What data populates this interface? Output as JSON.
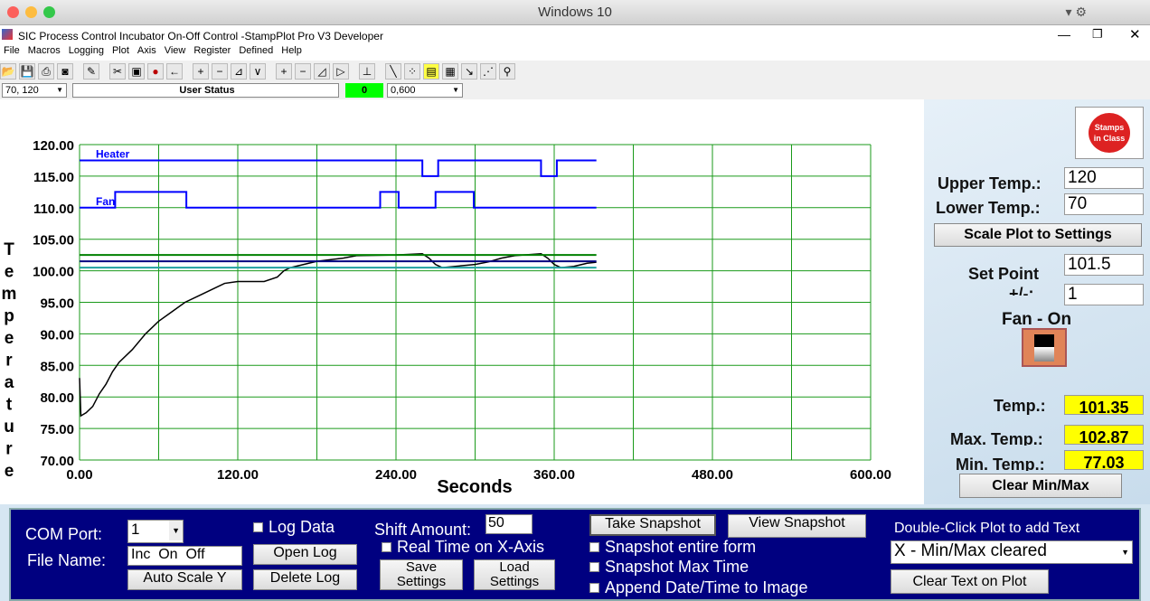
{
  "os_title": "Windows 10",
  "window": {
    "title": "SIC Process Control Incubator On-Off Control -StampPlot Pro V3 Developer"
  },
  "menu": [
    "File",
    "Macros",
    "Logging",
    "Plot",
    "Axis",
    "View",
    "Register",
    "Defined",
    "Help"
  ],
  "toolbar_icons": [
    "open-icon",
    "save-icon",
    "print-icon",
    "camera-icon",
    "eraser-icon",
    "tools-icon",
    "monitor-icon",
    "stop-icon",
    "back-arrow-icon",
    "plus-icon",
    "minus-icon",
    "zoom-in-icon",
    "zoom-out-icon",
    "plus-icon",
    "minus-icon",
    "expand-icon",
    "shrink-icon",
    "axis-icon",
    "pen-icon",
    "points-icon",
    "note-icon",
    "clipboard-icon",
    "probe-icon",
    "chart-icon",
    "magnifier-icon"
  ],
  "status": {
    "range": "70, 120",
    "user_status": "User Status",
    "count": "0",
    "xrange": "0,600"
  },
  "chart_data": {
    "type": "line",
    "xlabel": "Seconds",
    "ylabel": "Temperature",
    "xlim": [
      0,
      600
    ],
    "ylim": [
      70,
      120
    ],
    "xticks": [
      "0.00",
      "120.00",
      "240.00",
      "360.00",
      "480.00",
      "600.00"
    ],
    "yticks": [
      "70.00",
      "75.00",
      "80.00",
      "85.00",
      "90.00",
      "95.00",
      "100.00",
      "105.00",
      "110.00",
      "115.00",
      "120.00"
    ],
    "grid": true,
    "series": [
      {
        "name": "Heater",
        "color": "#0000ff",
        "x": [
          0,
          260,
          260,
          272,
          272,
          350,
          350,
          362,
          362,
          392
        ],
        "y": [
          117.5,
          117.5,
          115,
          115,
          117.5,
          117.5,
          115,
          115,
          117.5,
          117.5
        ]
      },
      {
        "name": "Fan",
        "color": "#0000ff",
        "x": [
          0,
          27,
          27,
          81,
          81,
          228,
          228,
          242,
          242,
          270,
          270,
          299,
          299,
          392
        ],
        "y": [
          110,
          110,
          112.5,
          112.5,
          110,
          110,
          112.5,
          112.5,
          110,
          110,
          112.5,
          112.5,
          110,
          110
        ]
      },
      {
        "color": "#000000",
        "x": [
          0,
          1,
          5,
          10,
          15,
          20,
          25,
          30,
          40,
          50,
          60,
          70,
          80,
          90,
          100,
          110,
          120,
          140,
          150,
          155,
          160,
          170,
          180,
          200,
          210,
          240,
          260,
          265,
          270,
          275,
          285,
          300,
          310,
          320,
          330,
          350,
          355,
          360,
          365,
          375,
          385,
          392
        ],
        "y": [
          83,
          77,
          77.5,
          78.5,
          80.5,
          82,
          84,
          85.5,
          87.5,
          90,
          92,
          93.5,
          95,
          96,
          97,
          98,
          98.3,
          98.3,
          99,
          100,
          100.5,
          101,
          101.5,
          102,
          102.4,
          102.5,
          102.7,
          102,
          101,
          100.5,
          100.7,
          101,
          101.4,
          102,
          102.4,
          102.7,
          102,
          101,
          100.5,
          100.7,
          101.2,
          101.35
        ]
      },
      {
        "color": "#008000",
        "x": [
          0,
          392
        ],
        "y": [
          102.5,
          102.5
        ]
      },
      {
        "color": "#000080",
        "x": [
          0,
          392
        ],
        "y": [
          101.5,
          101.5
        ]
      },
      {
        "color": "#20a0a0",
        "x": [
          0,
          392
        ],
        "y": [
          100.5,
          100.5
        ]
      }
    ]
  },
  "side": {
    "upper_label": "Upper Temp.:",
    "upper": "120",
    "lower_label": "Lower Temp.:",
    "lower": "70",
    "scale_btn": "Scale Plot to Settings",
    "setpoint_label": "Set Point",
    "setpoint": "101.5",
    "pm_label": "+/-:",
    "pm": "1",
    "fan_label": "Fan - On",
    "temp_label": "Temp.:",
    "temp": "101.35",
    "max_label": "Max. Temp.:",
    "max": "102.87",
    "min_label": "Min. Temp.:",
    "min": "77.03",
    "clear_btn": "Clear Min/Max"
  },
  "bottom": {
    "com_label": "COM Port:",
    "com": "1",
    "file_label": "File Name:",
    "file": "Inc  On  Off",
    "auto_btn": "Auto Scale Y",
    "log_data": "Log Data",
    "open_log": "Open Log",
    "delete_log": "Delete Log",
    "shift_label": "Shift Amount:",
    "shift": "50",
    "realtime": "Real Time on X-Axis",
    "save_btn": "Save Settings",
    "load_btn": "Load Settings",
    "take_snap": "Take Snapshot",
    "view_snap": "View Snapshot",
    "snap_form": "Snapshot entire form",
    "snap_max": "Snapshot Max Time",
    "append": "Append Date/Time to Image",
    "dbl_label": "Double-Click Plot to add Text",
    "text_sel": "X - Min/Max cleared",
    "clear_text": "Clear Text on Plot"
  }
}
